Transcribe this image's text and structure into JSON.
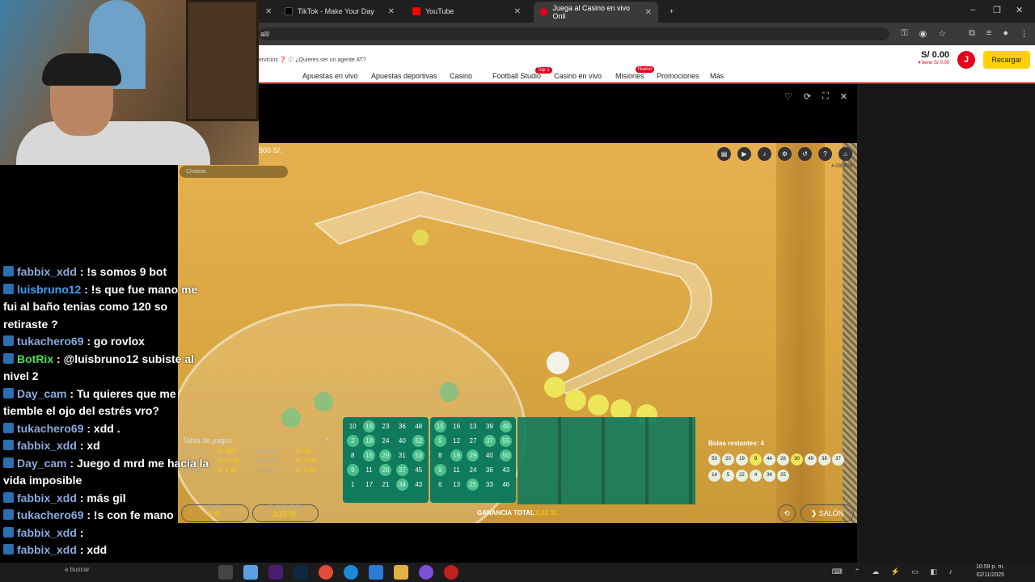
{
  "browser": {
    "tabs": [
      {
        "label": "TikTok - Make Your Day",
        "active": false
      },
      {
        "label": "YouTube",
        "active": false
      },
      {
        "label": "Juega al Casino en vivo Onli",
        "active": true
      }
    ],
    "new_tab": "+",
    "url": "all/"
  },
  "site": {
    "top_links": "ervicios ❓ ⓘ ¿Quieres ser un agente AT?",
    "nav": [
      {
        "label": "Apuestas en vivo"
      },
      {
        "label": "Apuestas deportivas"
      },
      {
        "label": "Casino"
      },
      {
        "label": "Football Studio",
        "badge": "Top 1"
      },
      {
        "label": "Casino en vivo"
      },
      {
        "label": "Misiones",
        "badge": "Nuevo"
      },
      {
        "label": "Promociones"
      },
      {
        "label": "Más"
      }
    ],
    "balance": "S/ 0.00",
    "balance_sub": "▾ tiene S/ 0.00",
    "avatar_letter": "J",
    "recharge_label": "Recargar",
    "brand_color": "#e2001a",
    "accent_color": "#ffd100"
  },
  "game": {
    "jackpot_text": "500 S/.",
    "chat_placeholder": "Chatear",
    "game_id": "# 035B29",
    "paytable": {
      "title": "Tabla de pagos",
      "rows": [
        [
          "6+ líneas",
          "S/. 500",
          "5 líneas",
          "S/. 50"
        ],
        [
          "4 líneas",
          "S/. 12,50",
          "3 líneas",
          "S/. 2,50"
        ],
        [
          "2 líneas",
          "S/. 0,25",
          "1 línea",
          "S/. 0,05"
        ]
      ]
    },
    "card1": [
      [
        "10",
        "19",
        "23",
        "36",
        "48"
      ],
      [
        "2",
        "18",
        "24",
        "40",
        "52"
      ],
      [
        "8",
        "16",
        "29",
        "31",
        "53"
      ],
      [
        "9",
        "11",
        "26",
        "37",
        "45"
      ],
      [
        "1",
        "17",
        "21",
        "34",
        "43"
      ]
    ],
    "card1_hits": [
      "0-1",
      "1-0",
      "1-1",
      "1-4",
      "2-1",
      "2-2",
      "2-4",
      "3-0",
      "3-2",
      "3-3",
      "4-3"
    ],
    "card2": [
      [
        "15",
        "16",
        "13",
        "39",
        "49"
      ],
      [
        "5",
        "12",
        "27",
        "37",
        "55"
      ],
      [
        "8",
        "19",
        "29",
        "40",
        "50"
      ],
      [
        "9",
        "11",
        "24",
        "36",
        "43"
      ],
      [
        "6",
        "13",
        "25",
        "33",
        "46"
      ]
    ],
    "card2_hits": [
      "0-0",
      "0-4",
      "1-0",
      "1-3",
      "1-4",
      "2-1",
      "2-2",
      "2-4",
      "3-0",
      "4-2"
    ],
    "bolas_label": "Bolas restantes: 4",
    "balls_row1": [
      "50",
      "20",
      "19",
      "9",
      "44",
      "28",
      "30",
      "49",
      "38",
      "37"
    ],
    "balls_row2": [
      "14",
      "5",
      "22",
      "4",
      "34",
      "25"
    ],
    "saldo_label": "SALDO",
    "saldo_value": "0 S/.",
    "apuesta_label": "APUESTA TOTAL",
    "apuesta_value": "3,25 S/.",
    "ganancia_label": "GANANCIA TOTAL",
    "ganancia_value": "0,10 S/.",
    "salon_label": "SALÓN"
  },
  "chat": [
    {
      "user": "fabbix_xdd",
      "text": " : !s somos 9 bot",
      "color": "#8ad"
    },
    {
      "user": "luisbruno12",
      "text": " : !s que fue mano me fui al baño tenias como 120 so retiraste ?",
      "color": "#3aa0ff"
    },
    {
      "user": "tukachero69",
      "text": " : go rovlox",
      "color": "#8ad"
    },
    {
      "user": "BotRix",
      "text": " : @luisbruno12 subiste al nivel 2",
      "color": "#4ce05a"
    },
    {
      "user": "Day_cam",
      "text": " : Tu quieres que me tiemble el ojo del estrés vro?",
      "color": "#8ad"
    },
    {
      "user": "tukachero69",
      "text": " : xdd .",
      "color": "#8ad"
    },
    {
      "user": "fabbix_xdd",
      "text": " : xd",
      "color": "#8ad"
    },
    {
      "user": "Day_cam",
      "text": " : Juego d mrd me hacia la vida imposible",
      "color": "#8ad"
    },
    {
      "user": "fabbix_xdd",
      "text": " : más gil",
      "color": "#8ad"
    },
    {
      "user": "tukachero69",
      "text": " : !s con fe mano",
      "color": "#8ad"
    },
    {
      "user": "fabbix_xdd",
      "text": " : ",
      "color": "#8ad"
    },
    {
      "user": "fabbix_xdd",
      "text": " : xdd",
      "color": "#8ad"
    }
  ],
  "taskbar": {
    "search": "a buscar",
    "time": "10:59 p. m.",
    "date": "02/11/2025"
  }
}
